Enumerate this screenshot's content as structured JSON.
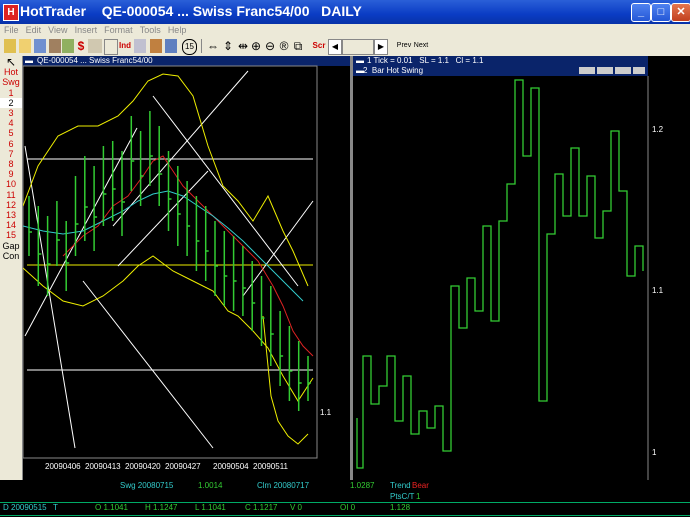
{
  "window": {
    "app_name": "HotTrader",
    "title": "QE-000054 ... Swiss Franc54/00",
    "period": "DAILY"
  },
  "menu": [
    "File",
    "Edit",
    "View",
    "Insert",
    "Format",
    "Tools",
    "Help"
  ],
  "toolbar": {
    "dollar": "$",
    "ind": "Ind",
    "num15": "15",
    "scr": "Scr",
    "prev": "Prev",
    "next": "Next"
  },
  "sidebar": {
    "top_labels": [
      "Hot",
      "Swg"
    ],
    "numbers": [
      "1",
      "2",
      "3",
      "4",
      "5",
      "6",
      "7",
      "8",
      "9",
      "10",
      "11",
      "12",
      "13",
      "14",
      "15"
    ],
    "selected": "2",
    "bottom_labels": [
      "Gap",
      "Con"
    ]
  },
  "left_chart": {
    "header": "QE-000054 ... Swiss Franc54/00",
    "x_ticks": [
      "20090406",
      "20090413",
      "20090420",
      "20090427",
      "20090504",
      "20090511"
    ],
    "y_label": "1.1"
  },
  "right_chart": {
    "header_line1": "1 Tick = 0.01   SL = 1.1   Cl = 1.1",
    "header_line2": "2  Bar Hot Swing",
    "y_labels": [
      "1.2",
      "1.1",
      "1"
    ]
  },
  "status": {
    "row1": {
      "swg": "Swg 20080715",
      "swg_val": "1.0014",
      "clm": "Clm 20080717",
      "clm_val": "1.0287",
      "trend_label": "Trend",
      "trend_val": "Bear"
    },
    "row2": {
      "pts_label": "PtsC/T",
      "pts_val": "1"
    },
    "row3": {
      "d": "D 20090515",
      "t": "T",
      "o": "O 1.1041",
      "h": "H 1.1247",
      "l": "L 1.1041",
      "c": "C 1.1217",
      "v": "V 0",
      "oi": "OI 0",
      "last": "1.128"
    }
  }
}
